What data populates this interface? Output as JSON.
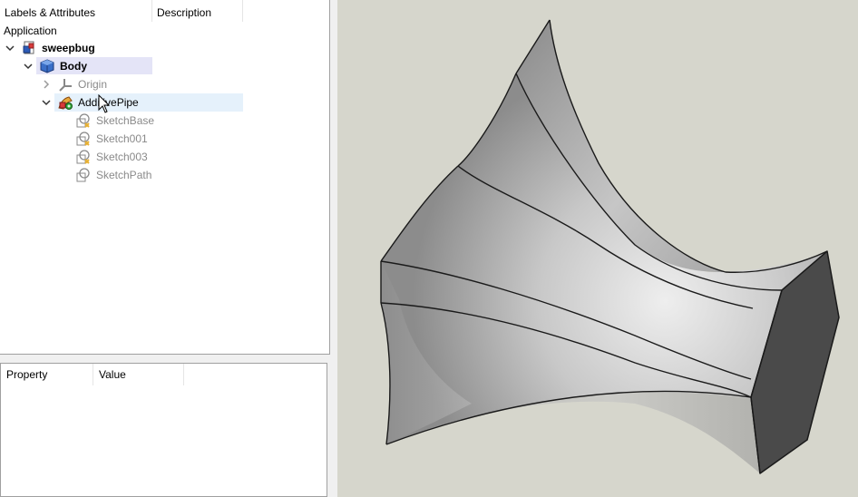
{
  "tree": {
    "columns": [
      "Labels & Attributes",
      "Description"
    ],
    "root_label": "Application",
    "items": [
      {
        "label": "sweepbug",
        "icon": "document-icon"
      },
      {
        "label": "Body",
        "icon": "body-icon"
      },
      {
        "label": "Origin",
        "icon": "origin-icon"
      },
      {
        "label": "AdditivePipe",
        "icon": "additive-pipe-icon"
      },
      {
        "label": "SketchBase",
        "icon": "sketch-icon"
      },
      {
        "label": "Sketch001",
        "icon": "sketch-icon"
      },
      {
        "label": "Sketch003",
        "icon": "sketch-icon"
      },
      {
        "label": "SketchPath",
        "icon": "sketch-icon"
      }
    ]
  },
  "property_panel": {
    "columns": [
      "Property",
      "Value"
    ]
  },
  "colors": {
    "viewport_background": "#d6d6cc",
    "selection_body": "#e4e4f7",
    "selection_pipe": "#e5f1fb",
    "hidden_text": "#8a8a8a"
  }
}
